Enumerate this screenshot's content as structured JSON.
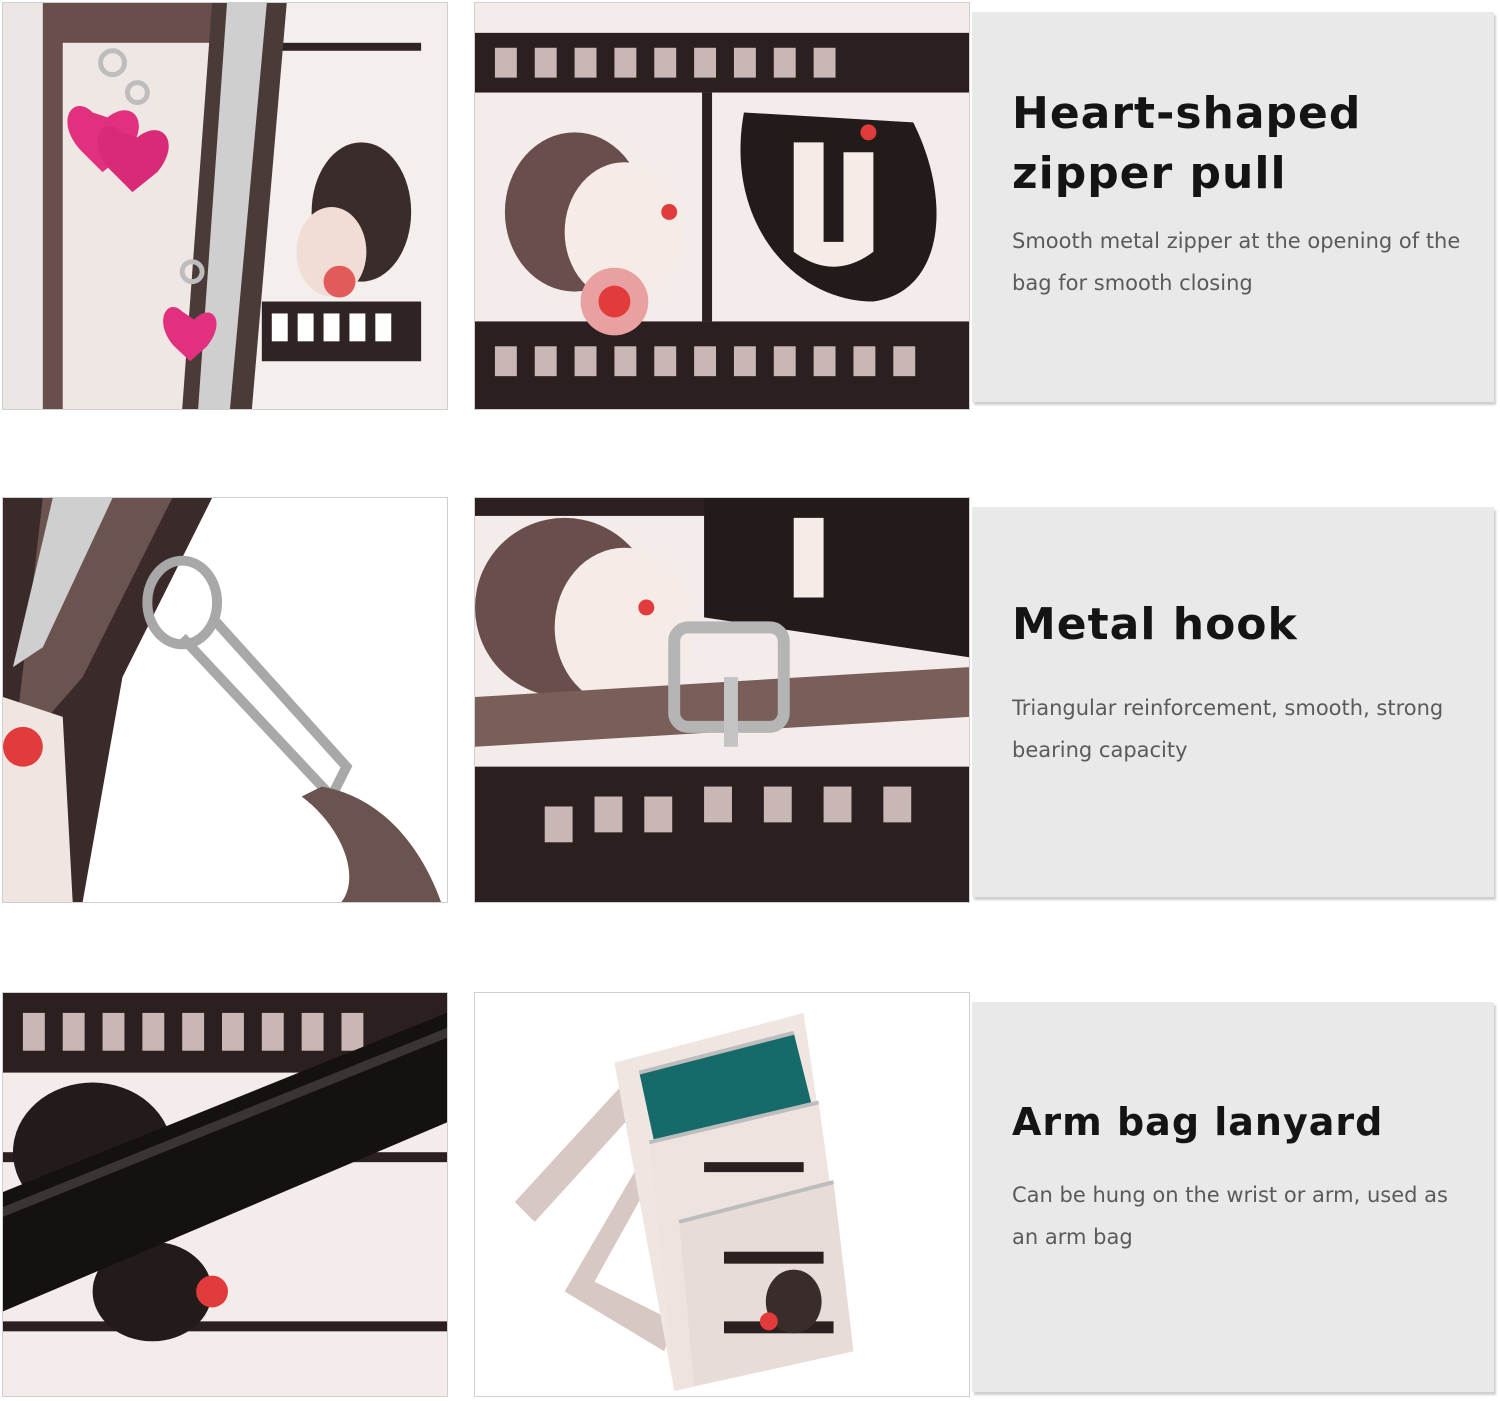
{
  "features": [
    {
      "title": "Heart-shaped zipper pull",
      "description": "Smooth metal zipper at the opening of the bag for smooth closing"
    },
    {
      "title": "Metal hook",
      "description": "Triangular reinforcement, smooth, strong bearing capacity"
    },
    {
      "title": "Arm bag lanyard",
      "description": "Can be hung on the wrist or arm, used as an arm bag"
    }
  ],
  "photos": [
    "heart-zipper-pulls-closeup",
    "film-strip-cartoon-fabric-closeup",
    "metal-lobster-clasp-closeup",
    "metal-buckle-strap-closeup",
    "black-elastic-band-closeup",
    "crossbody-phone-bag-product"
  ],
  "colors": {
    "card_background": "#e9e9e9",
    "title_text": "#141414",
    "description_text": "#5a5a5a",
    "heart_pink": "#e0307e",
    "fabric_brown": "#5a4040"
  }
}
